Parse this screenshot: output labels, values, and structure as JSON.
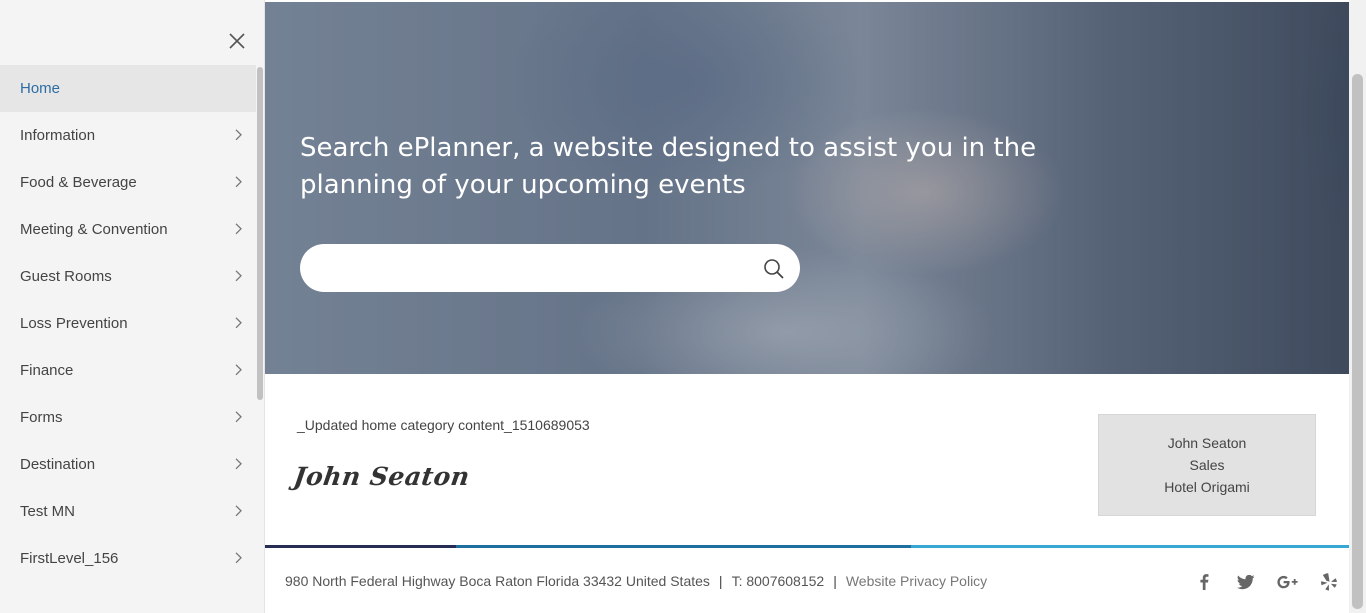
{
  "sidebar": {
    "items": [
      {
        "label": "Home"
      },
      {
        "label": "Information"
      },
      {
        "label": "Food & Beverage"
      },
      {
        "label": "Meeting & Convention"
      },
      {
        "label": "Guest Rooms"
      },
      {
        "label": "Loss Prevention"
      },
      {
        "label": "Finance"
      },
      {
        "label": "Forms"
      },
      {
        "label": "Destination"
      },
      {
        "label": "Test MN"
      },
      {
        "label": "FirstLevel_156"
      }
    ],
    "active_label": "Home"
  },
  "hero": {
    "title": "Search ePlanner, a website designed to assist you in the planning of your upcoming events",
    "search_placeholder": "",
    "search_value": ""
  },
  "content": {
    "updated_text": "_Updated home category content_1510689053",
    "signature": "John Seaton"
  },
  "contact": {
    "name": "John Seaton",
    "role": "Sales",
    "hotel": "Hotel Origami"
  },
  "footer": {
    "address": "980 North Federal Highway Boca Raton Florida 33432 United States",
    "separator": "|",
    "phone": "T: 8007608152",
    "privacy": "Website Privacy Policy",
    "social_icons": [
      "facebook-icon",
      "twitter-icon",
      "google-plus-icon",
      "yelp-icon"
    ]
  },
  "colors": {
    "accent": "#2e6da4",
    "footer_bar_1": "#272c54",
    "footer_bar_2": "#1e6f9f",
    "footer_bar_3": "#36a9d2"
  }
}
